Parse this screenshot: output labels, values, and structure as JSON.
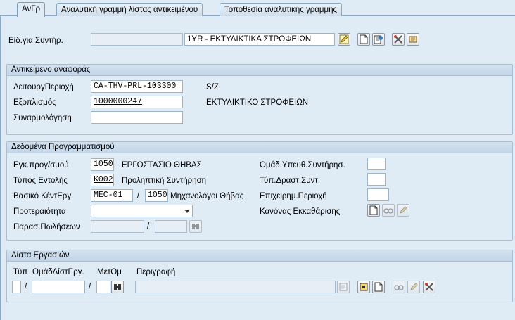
{
  "tabs": [
    {
      "label": "ΑνΓρ"
    },
    {
      "label": "Αναλυτική γραμμή λίστας αντικειμένου"
    },
    {
      "label": "Τοποθεσία αναλυτικής γραμμής"
    }
  ],
  "header": {
    "maint_type_label": "Είδ.για Συντήρ.",
    "maint_type_code": "",
    "maint_type_value": "1YR - ΕΚΤΥΛΙΚΤΙΚΑ ΣΤΡΟΦΕΙΩΝ"
  },
  "reference_object": {
    "title": "Αντικείμενο αναφοράς",
    "func_loc_label": "ΛειτουργΠεριοχή",
    "func_loc_value": "CA-THV-PRL-103300",
    "func_loc_desc": "S/Z",
    "equipment_label": "Εξοπλισμός",
    "equipment_value": "1000000247",
    "equipment_desc": "ΕΚΤΥΛΙΚΤΙΚΟ ΣΤΡΟΦΕΙΩΝ",
    "assembly_label": "Συναρμολόγηση",
    "assembly_value": ""
  },
  "planning_data": {
    "title": "Δεδομένα Προγραμματισμού",
    "plant_label": "Εγκ.προγ/σμού",
    "plant_value": "1050",
    "plant_desc": "ΕΡΓΟΣΤΑΣΙΟ ΘΗΒΑΣ",
    "order_type_label": "Τύπος Εντολής",
    "order_type_value": "K002",
    "order_type_desc": "Προληπτική Συντήρηση",
    "work_center_label": "Βασικό ΚέντΕργ",
    "work_center_value": "MEC-01",
    "work_center_plant": "1050",
    "work_center_desc": "Μηχανολόγοι Θήβας",
    "priority_label": "Προτεραιότητα",
    "priority_value": "",
    "sales_doc_label": "Παρασ.Πωλήσεων",
    "sales_doc_value": "",
    "sales_doc_item": "",
    "planner_group_label": "Ομάδ.Υπευθ.Συντήρησ.",
    "activity_type_label": "Τύπ.Δραστ.Συντ.",
    "business_area_label": "Επιχειρημ.Περιοχή",
    "settlement_rule_label": "Κανόνας Εκκαθάρισης"
  },
  "task_list": {
    "title": "Λίστα Εργασιών",
    "col_type": "Τύπ",
    "col_group": "ΟμάδΛίστΕργ.",
    "col_counter": "ΜετΟμ",
    "col_desc": "Περιγραφή",
    "sep1": "/",
    "sep2": "/"
  }
}
